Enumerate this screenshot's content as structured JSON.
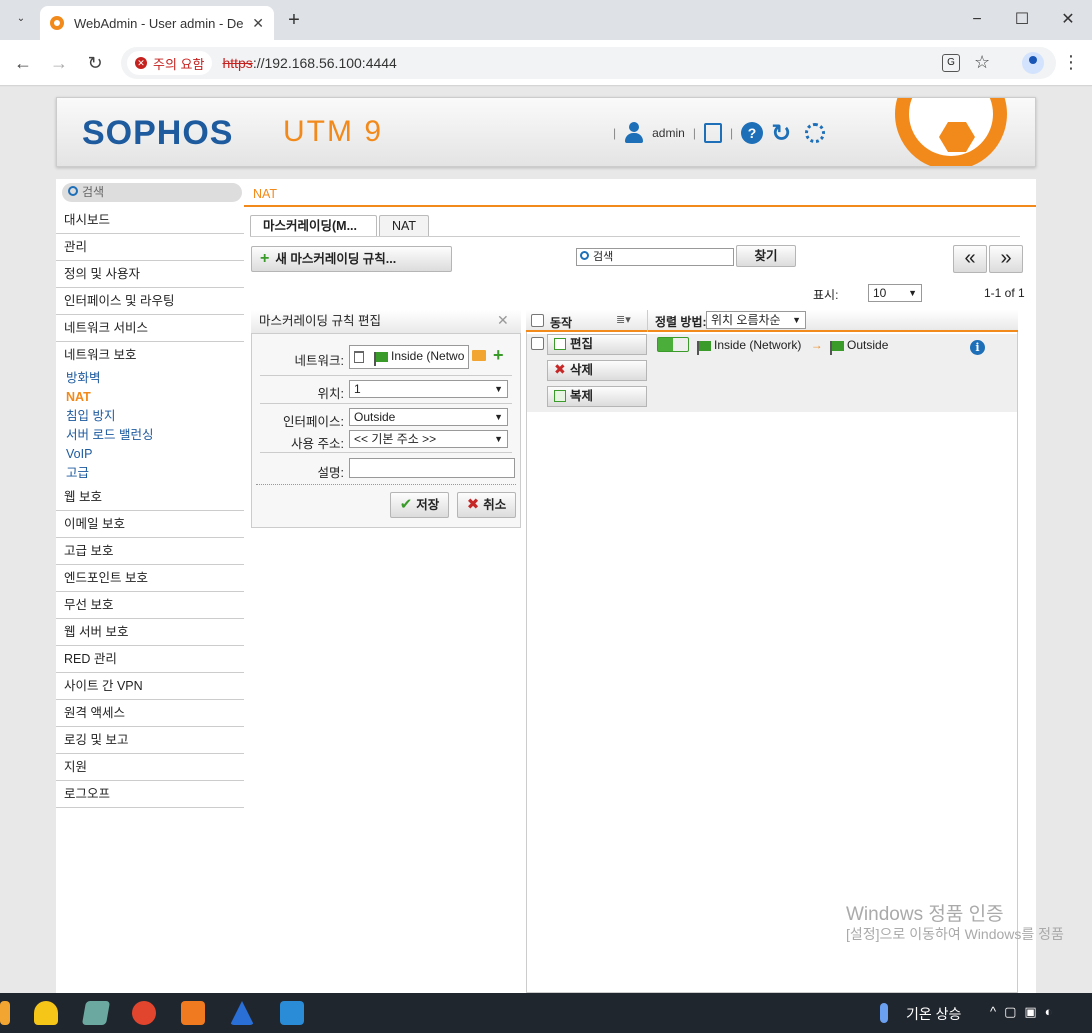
{
  "browser": {
    "tab_title": "WebAdmin - User admin - De",
    "security_chip": "주의 요함",
    "url_scheme": "https",
    "url_rest": "://192.168.56.100:4444"
  },
  "header": {
    "brand": "SOPHOS",
    "product": "UTM 9",
    "user": "admin"
  },
  "sidebar": {
    "search_placeholder": "검색",
    "items": [
      "대시보드",
      "관리",
      "정의 및 사용자",
      "인터페이스 및 라우팅",
      "네트워크 서비스",
      "네트워크 보호"
    ],
    "subitems": [
      "방화벽",
      "NAT",
      "침입 방지",
      "서버 로드 밸런싱",
      "VoIP",
      "고급"
    ],
    "items2": [
      "웹 보호",
      "이메일 보호",
      "고급 보호",
      "엔드포인트 보호",
      "무선 보호",
      "웹 서버 보호",
      "RED 관리",
      "사이트 간 VPN",
      "원격 액세스",
      "로깅 및 보고",
      "지원",
      "로그오프"
    ]
  },
  "main": {
    "breadcrumb": "NAT",
    "tabs": [
      "마스커레이딩(M...",
      "NAT"
    ],
    "new_rule_button": "새 마스커레이딩 규칙...",
    "search_placeholder": "검색",
    "find_button": "찾기",
    "display_label": "표시:",
    "display_value": "10",
    "count": "1-1 of 1"
  },
  "edit_panel": {
    "title": "마스커레이딩 규칙 편집",
    "network_label": "네트워크:",
    "network_value": "Inside (Netwo",
    "position_label": "위치:",
    "position_value": "1",
    "interface_label": "인터페이스:",
    "interface_value": "Outside",
    "address_label": "사용 주소:",
    "address_value": "<< 기본 주소 >>",
    "comment_label": "설명:",
    "save_button": "저장",
    "cancel_button": "취소"
  },
  "list": {
    "action_header": "동작",
    "sort_label": "정렬 방법:",
    "sort_value": "위치 오름차순",
    "edit_button": "편집",
    "delete_button": "삭제",
    "clone_button": "복제",
    "rule_source": "Inside (Network)",
    "rule_arrow": "→",
    "rule_dest": "Outside"
  },
  "watermark": {
    "line1": "Windows 정품 인증",
    "line2": "[설정]으로 이동하여 Windows를 정품"
  },
  "taskbar": {
    "weather": "기온 상승"
  },
  "colors": {
    "accent": "#f28a1b",
    "brand": "#1d5a9e",
    "green": "#3a9a2a"
  }
}
